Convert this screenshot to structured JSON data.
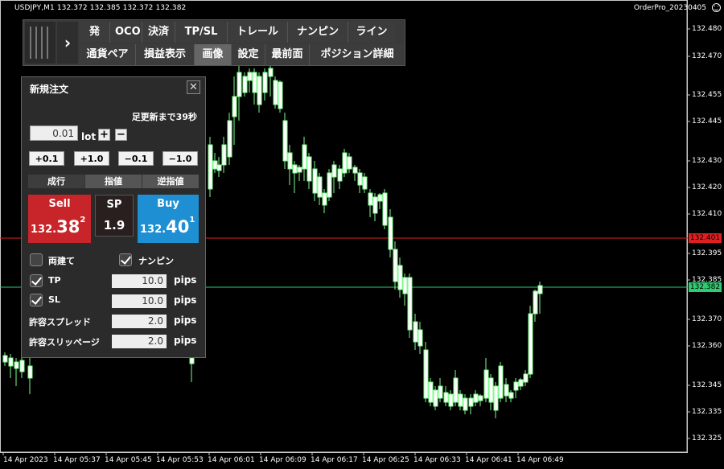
{
  "header": {
    "symbol_info": "USDJPY,M1  132.372 132.385 132.372 132.382",
    "ea_name": "OrderPro_20230405"
  },
  "toolbar": {
    "row1": [
      "発注",
      "OCO",
      "決済",
      "TP/SL",
      "トレール",
      "ナンピン",
      "ライン"
    ],
    "row2": [
      "通貨ペア",
      "損益表示",
      "画像",
      "設定",
      "最前面",
      "ポジション詳細"
    ],
    "active": "画像"
  },
  "panel": {
    "title": "新規注文",
    "close": "✕",
    "countdown": "足更新まで39秒",
    "lot_value": "0.01",
    "lot_label": "lot",
    "plus": "+",
    "minus": "−",
    "steps": [
      "+0.1",
      "+1.0",
      "−0.1",
      "−1.0"
    ],
    "order_tabs": [
      "成行",
      "指値",
      "逆指値"
    ],
    "sell": {
      "label": "Sell",
      "price_prefix": "132.",
      "price_big": "38",
      "price_sup": "2"
    },
    "spread": {
      "label": "SP",
      "value": "1.9"
    },
    "buy": {
      "label": "Buy",
      "price_prefix": "132.",
      "price_big": "40",
      "price_sup": "1"
    },
    "hedge_label": "両建て",
    "nanpin_label": "ナンピン",
    "tp_label": "TP",
    "tp_value": "10.0",
    "sl_label": "SL",
    "sl_value": "10.0",
    "spread_allow_label": "許容スプレッド",
    "spread_allow_value": "2.0",
    "slip_label": "許容スリッページ",
    "slip_value": "2.0",
    "unit": "pips"
  },
  "price_axis": {
    "labels": [
      "132.480",
      "132.470",
      "132.455",
      "132.445",
      "132.430",
      "132.420",
      "132.410",
      "132.395",
      "132.385",
      "132.370",
      "132.360",
      "132.345",
      "132.335",
      "132.325"
    ],
    "sell_tag": "132.401",
    "buy_tag": "132.382",
    "sell_color": "#e02020",
    "buy_color": "#2ecc71"
  },
  "time_axis": {
    "labels": [
      "14 Apr 2023",
      "14 Apr 05:37",
      "14 Apr 05:45",
      "14 Apr 05:53",
      "14 Apr 06:01",
      "14 Apr 06:09",
      "14 Apr 06:17",
      "14 Apr 06:25",
      "14 Apr 06:33",
      "14 Apr 06:41",
      "14 Apr 06:49"
    ]
  }
}
